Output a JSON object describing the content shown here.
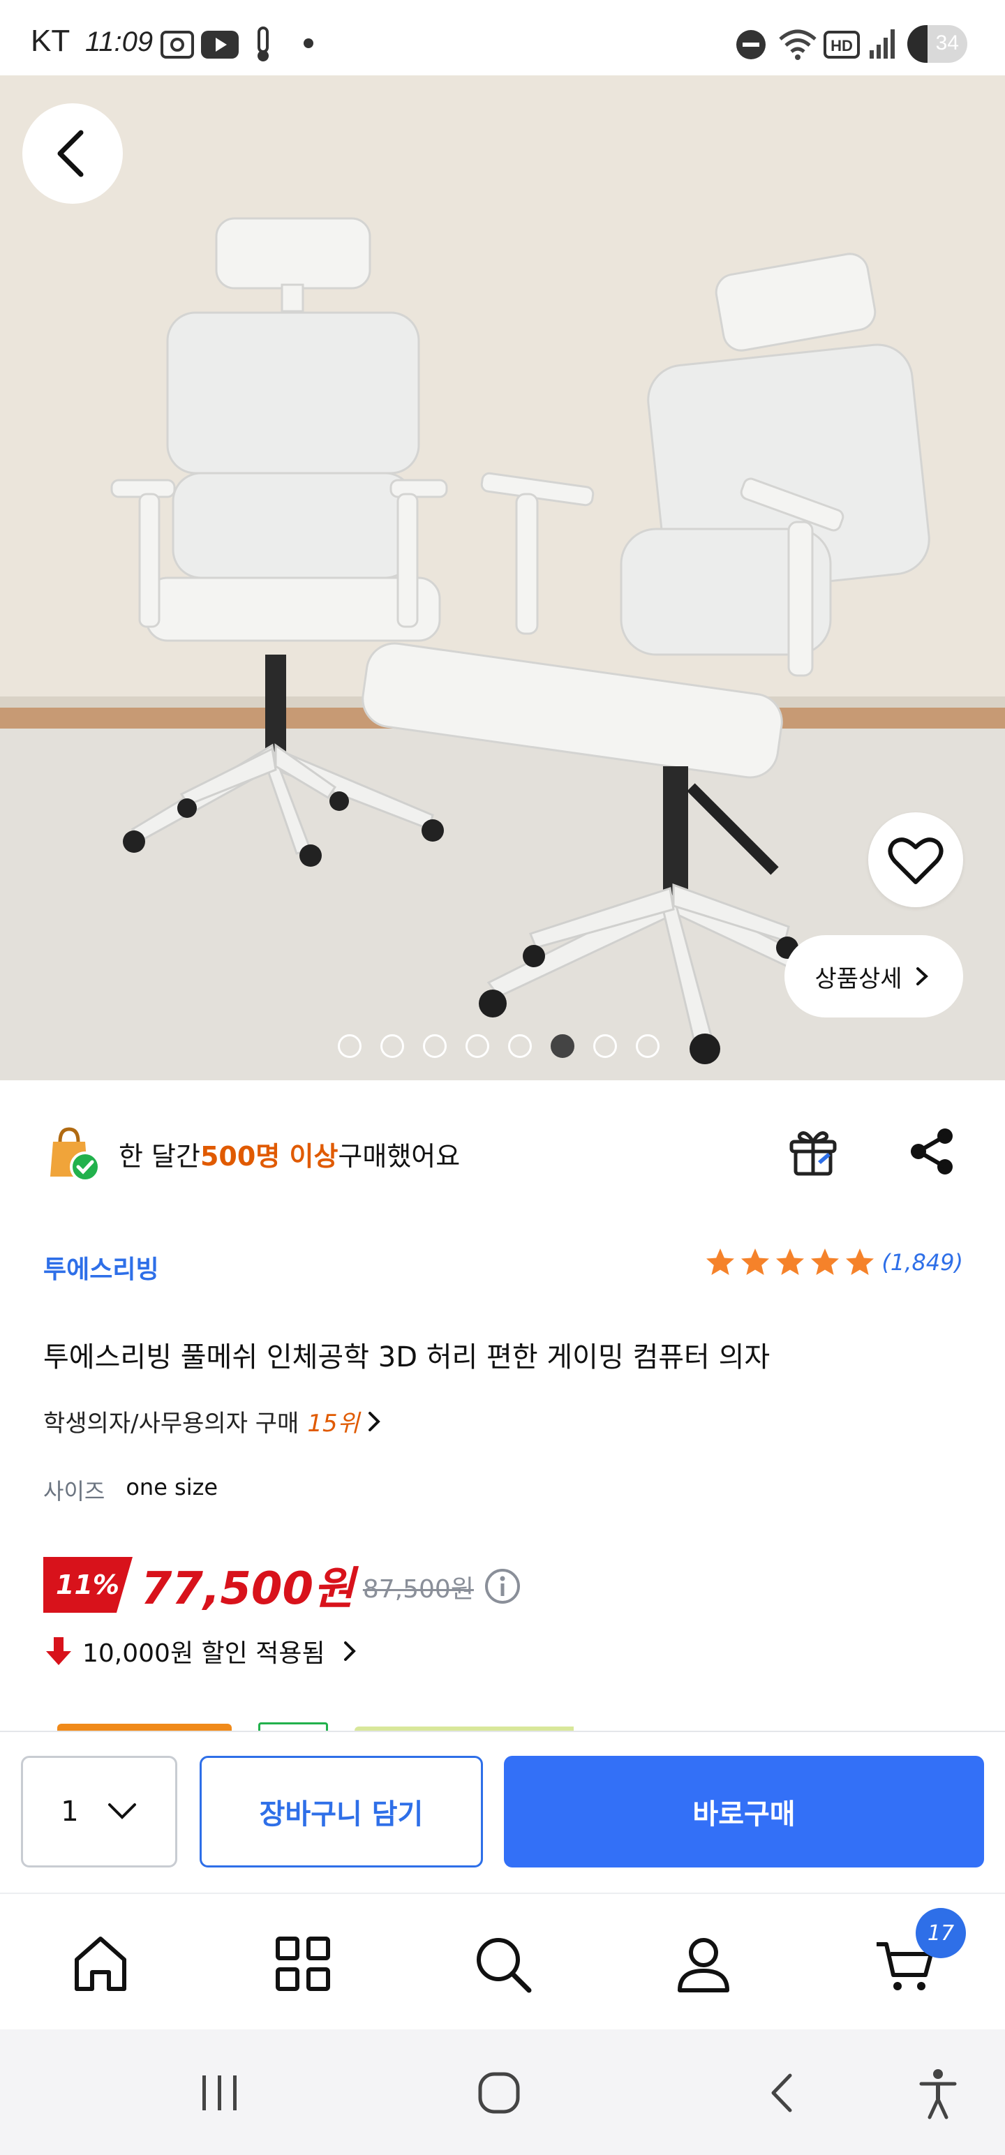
{
  "status_bar": {
    "carrier": "KT",
    "time": "11:09",
    "battery": "34",
    "battery_level": 0.34,
    "icons": [
      "screenshot-icon",
      "youtube-icon",
      "thermometer-icon",
      "dot-icon",
      "do-not-disturb-icon",
      "wifi-icon",
      "hd-icon",
      "signal-icon",
      "battery-icon"
    ]
  },
  "hero": {
    "image": "two-white-ergonomic-office-chairs-photo",
    "detail_button": "상품상세",
    "carousel": {
      "total_pages": 8,
      "active_index": 5
    }
  },
  "purchase_info": {
    "prefix": "한 달간 ",
    "highlight": "500명 이상",
    "suffix": " 구매했어요"
  },
  "product": {
    "brand": "투에스리빙",
    "rating_stars": 5,
    "review_count": "(1,849)",
    "title": "투에스리빙 풀메쉬 인체공학 3D 허리 편한 게이밍 컴퓨터 의자",
    "rank_category": "학생의자/사무용의자 구매",
    "rank_number": "15위",
    "size_label": "사이즈",
    "size_value": "one size",
    "discount_rate": "11%",
    "price": "77,500원",
    "original_price": "87,500원",
    "coupon_text": "10,000원 할인 적용됨"
  },
  "actions": {
    "quantity": "1",
    "cart_button": "장바구니 담기",
    "buy_button": "바로구매"
  },
  "bottom_nav": {
    "items": [
      "home-icon",
      "category-icon",
      "search-icon",
      "my-page-icon",
      "cart-icon"
    ],
    "cart_count": "17"
  },
  "system_nav": [
    "recents-icon",
    "home-circle-icon",
    "back-icon",
    "accessibility-icon"
  ],
  "colors": {
    "accent_blue": "#3370f7",
    "brand_blue": "#2e6fe8",
    "price_red": "#d8121b",
    "highlight_orange": "#e05a00",
    "star_orange": "#f5822a"
  }
}
